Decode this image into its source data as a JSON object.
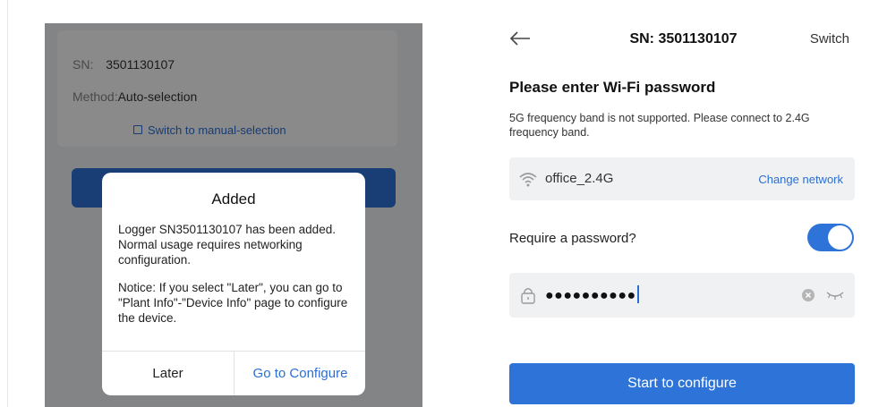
{
  "left": {
    "sn_label": "SN:",
    "sn_value": "3501130107",
    "method_label": "Method:",
    "method_value": "Auto-selection",
    "switch_link": "Switch to manual-selection",
    "dialog": {
      "title": "Added",
      "message1": "Logger SN3501130107 has been added. Normal usage requires networking configuration.",
      "message2": "Notice: If you select \"Later\", you can go to \"Plant Info\"-\"Device Info\" page to configure the device.",
      "later_label": "Later",
      "configure_label": "Go to Configure"
    }
  },
  "right": {
    "title": "SN: 3501130107",
    "switch_label": "Switch",
    "heading": "Please enter Wi-Fi password",
    "note": "5G frequency band is not supported. Please connect to 2.4G frequency band.",
    "network_name": "office_2.4G",
    "change_network_label": "Change network",
    "require_password_label": "Require a password?",
    "require_password_on": true,
    "password_masked": "●●●●●●●●●●",
    "start_button_label": "Start to configure"
  },
  "colors": {
    "accent": "#2e73d8",
    "link": "#2b6fd4",
    "field_bg": "#f0f1f3"
  },
  "icons": [
    "back-arrow-icon",
    "wifi-icon",
    "lock-icon",
    "clear-icon",
    "eye-closed-icon",
    "switch-square-icon"
  ]
}
